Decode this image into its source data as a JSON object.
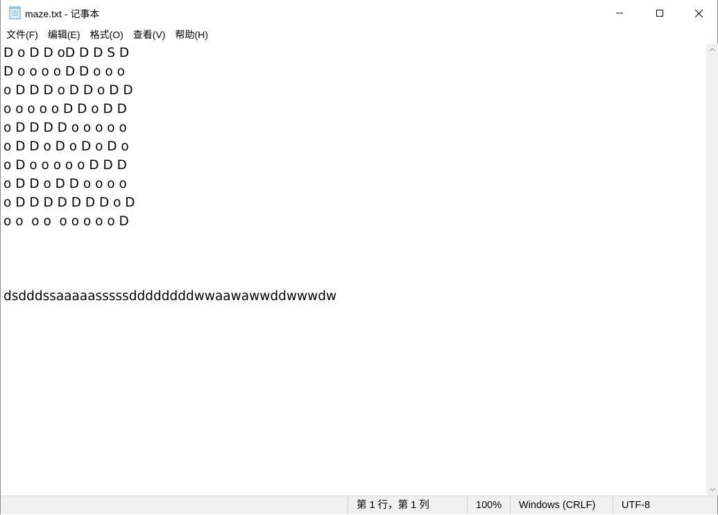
{
  "window": {
    "title": "maze.txt - 记事本",
    "app_icon": "notepad-icon"
  },
  "menu": {
    "items": [
      "文件(F)",
      "编辑(E)",
      "格式(O)",
      "查看(V)",
      "帮助(H)"
    ]
  },
  "editor": {
    "lines": [
      "D o D D oD D D S D",
      "D o o o o D D o o o",
      "o D D D o D D o D D",
      "o o o o o D D o D D",
      "o D D D D o o o o o",
      "o D D o D o D o D o",
      "o D o o o o o D D D",
      "o D D o D D o o o o",
      "o D D D D D D D o D",
      "o o  o o  o o o o o D",
      "",
      "",
      "",
      "dsdddssaaaaasssssddddddddwwaawawwddwwwdw"
    ]
  },
  "statusbar": {
    "position": "第 1 行，第 1 列",
    "zoom": "100%",
    "line_ending": "Windows (CRLF)",
    "encoding": "UTF-8"
  },
  "colors": {
    "background": "#ffffff",
    "statusbar": "#f0f0f0",
    "scrollbar": "#f0f0f0"
  }
}
